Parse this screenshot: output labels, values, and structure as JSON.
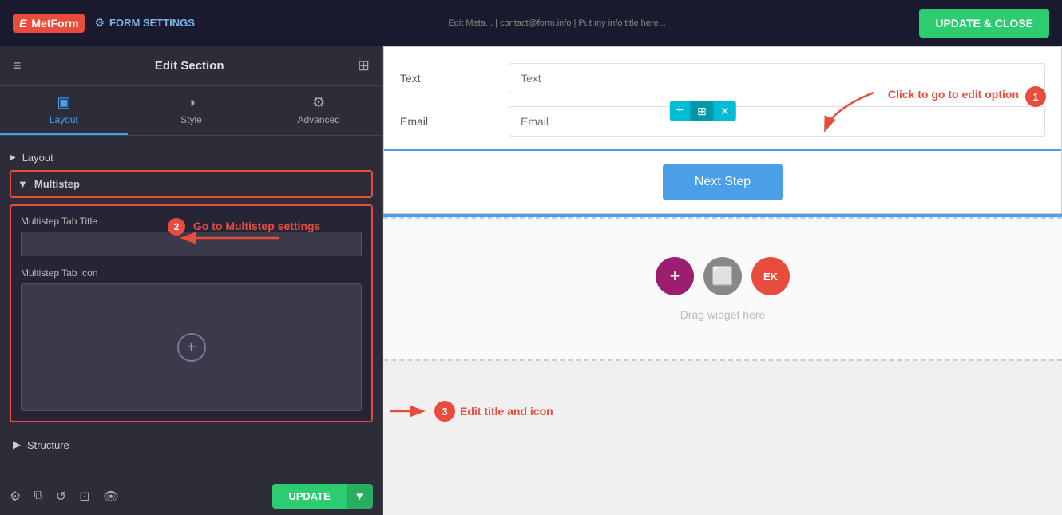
{
  "topbar": {
    "logo_text": "MetForm",
    "settings_label": "FORM SETTINGS",
    "update_close_label": "UPDATE & CLOSE",
    "breadcrumb": "Edit Meta... | contact@form.info | Put my info title here..."
  },
  "sidebar": {
    "header_title": "Edit Section",
    "tabs": [
      {
        "id": "layout",
        "label": "Layout",
        "icon": "▣"
      },
      {
        "id": "style",
        "label": "Style",
        "icon": "◑"
      },
      {
        "id": "advanced",
        "label": "Advanced",
        "icon": "⚙"
      }
    ],
    "layout_section": {
      "label": "Layout",
      "arrow": "▶"
    },
    "multistep_section": {
      "label": "Multistep",
      "arrow": "▼"
    },
    "multistep_tab_title_label": "Multistep Tab Title",
    "multistep_tab_icon_label": "Multistep Tab Icon",
    "structure_section": {
      "label": "Structure",
      "arrow": "▶"
    }
  },
  "bottom_bar": {
    "update_label": "UPDATE",
    "dropdown_arrow": "▼"
  },
  "form": {
    "text_label": "Text",
    "text_placeholder": "Text",
    "email_label": "Email",
    "email_placeholder": "Email",
    "next_step_label": "Next Step",
    "drag_widget_text": "Drag widget here"
  },
  "annotations": {
    "callout1": "Click to go to edit option",
    "callout2": "Go to Multistep settings",
    "callout3": "Edit title and icon",
    "step1": "1",
    "step2": "2",
    "step3": "3"
  },
  "icons": {
    "hamburger": "≡",
    "grid": "⊞",
    "gear": "⚙",
    "layers": "⧉",
    "history": "↺",
    "responsive": "⊡",
    "eye": "👁",
    "plus": "+",
    "arrow_down": "▼",
    "close": "✕",
    "ek": "EK"
  }
}
